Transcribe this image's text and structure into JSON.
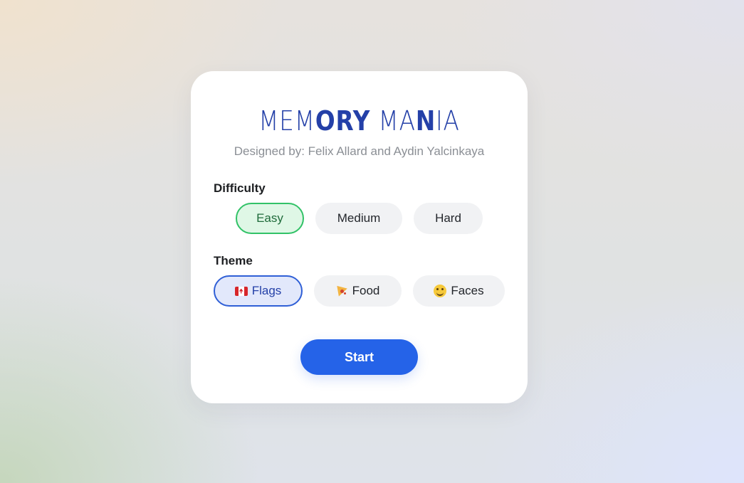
{
  "app": {
    "title_part1": "MEM",
    "title_part2": "ORY",
    "title_part3": " MA",
    "title_part4": "N",
    "title_part5": "IA",
    "subtitle": "Designed by: Felix Allard and Aydin Yalcinkaya"
  },
  "difficulty": {
    "label": "Difficulty",
    "options": [
      {
        "label": "Easy",
        "selected": true
      },
      {
        "label": "Medium",
        "selected": false
      },
      {
        "label": "Hard",
        "selected": false
      }
    ]
  },
  "theme": {
    "label": "Theme",
    "options": [
      {
        "label": "Flags",
        "icon": "canada-flag-icon",
        "selected": true
      },
      {
        "label": "Food",
        "icon": "pizza-icon",
        "selected": false
      },
      {
        "label": "Faces",
        "icon": "smiley-face-icon",
        "selected": false
      }
    ]
  },
  "start_label": "Start",
  "colors": {
    "title": "#2440a8",
    "selected_difficulty_border": "#31c267",
    "selected_theme_border": "#2f5fd6",
    "start_button": "#2563e8"
  }
}
